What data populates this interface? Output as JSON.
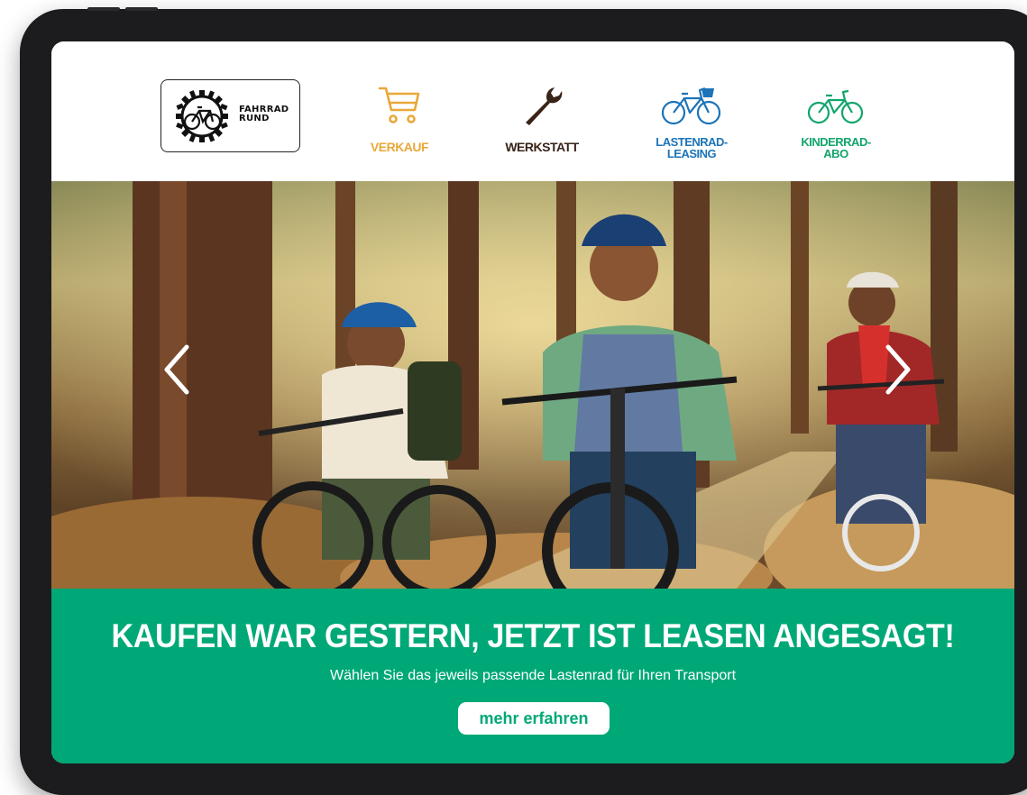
{
  "logo": {
    "line1": "FAHRRAD",
    "line2": "RUND",
    "icon": "gear-bicycle-icon"
  },
  "nav": [
    {
      "label": "VERKAUF",
      "icon": "shopping-cart-icon",
      "color": "#e9a83a"
    },
    {
      "label": "WERKSTATT",
      "icon": "wrench-icon",
      "color": "#3a2418"
    },
    {
      "label_line1": "LASTENRAD-",
      "label_line2": "LEASING",
      "icon": "cargo-bike-icon",
      "color": "#1d74b8"
    },
    {
      "label_line1": "KINDERRAD-",
      "label_line2": "ABO",
      "icon": "bicycle-icon",
      "color": "#12a56b"
    }
  ],
  "hero": {
    "prev_icon": "chevron-left-icon",
    "next_icon": "chevron-right-icon"
  },
  "banner": {
    "title": "KAUFEN WAR GESTERN, JETZT IST LEASEN ANGESAGT!",
    "subtitle": "Wählen Sie das jeweils passende Lastenrad für Ihren Transport",
    "button": "mehr erfahren",
    "background": "#00a877"
  }
}
